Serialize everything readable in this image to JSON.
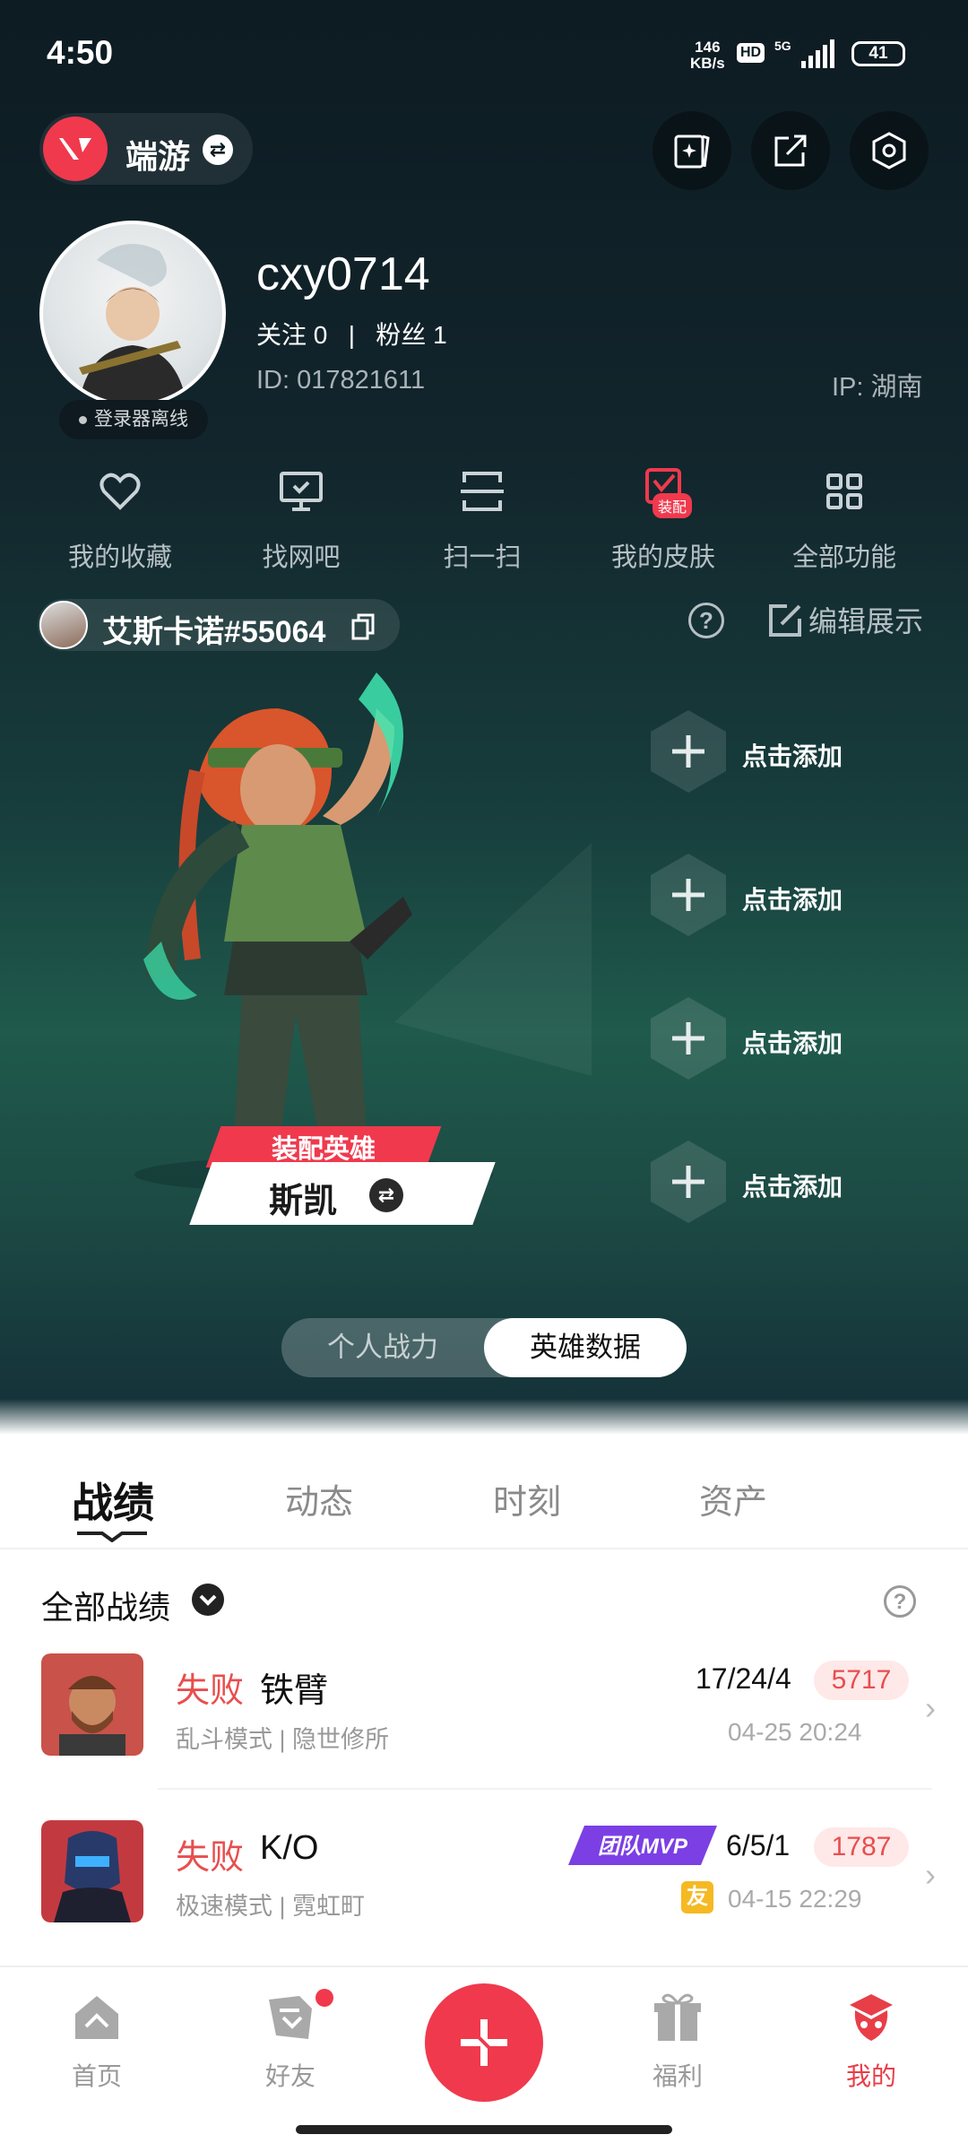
{
  "status": {
    "time": "4:50",
    "net_speed_top": "146",
    "net_speed_bottom": "KB/s",
    "hd": "HD",
    "network": "5G",
    "battery": "41"
  },
  "topbar": {
    "game": "端游"
  },
  "profile": {
    "username": "cxy0714",
    "follow_text": "关注 0   |   粉丝 1",
    "id_text": "ID: 017821611",
    "ip_text": "IP: 湖南",
    "offline": "登录器离线"
  },
  "quick": [
    {
      "label": "我的收藏",
      "icon": "heart-icon"
    },
    {
      "label": "找网吧",
      "icon": "monitor-icon"
    },
    {
      "label": "扫一扫",
      "icon": "scan-icon"
    },
    {
      "label": "我的皮肤",
      "icon": "skin-icon",
      "badge": "装配"
    },
    {
      "label": "全部功能",
      "icon": "grid-icon"
    }
  ],
  "player": {
    "name": "艾斯卡诺#55064",
    "edit_label": "编辑展示"
  },
  "hero": {
    "tag": "装配英雄",
    "name": "斯凯"
  },
  "slots": [
    {
      "label": "点击添加"
    },
    {
      "label": "点击添加"
    },
    {
      "label": "点击添加"
    },
    {
      "label": "点击添加"
    }
  ],
  "toggle": {
    "left": "个人战力",
    "right": "英雄数据"
  },
  "tabs": [
    "战绩",
    "动态",
    "时刻",
    "资产"
  ],
  "filter": {
    "label": "全部战绩"
  },
  "matches": [
    {
      "result": "失败",
      "hero": "铁臂",
      "mode": "乱斗模式 | 隐世修所",
      "kda": "17/24/4",
      "score": "5717",
      "date": "04-25 20:24"
    },
    {
      "result": "失败",
      "hero": "K/O",
      "mode": "极速模式 | 霓虹町",
      "kda": "6/5/1",
      "score": "1787",
      "date": "04-15 22:29",
      "mvp": "团队MVP",
      "friend": "友"
    }
  ],
  "nav": [
    {
      "label": "首页",
      "icon": "home-icon"
    },
    {
      "label": "好友",
      "icon": "friends-icon"
    },
    {
      "label": "福利",
      "icon": "gift-icon"
    },
    {
      "label": "我的",
      "icon": "profile-icon"
    }
  ],
  "colors": {
    "accent": "#f0394d",
    "bg_dark": "#0d1b22",
    "loss": "#e84e4e"
  }
}
